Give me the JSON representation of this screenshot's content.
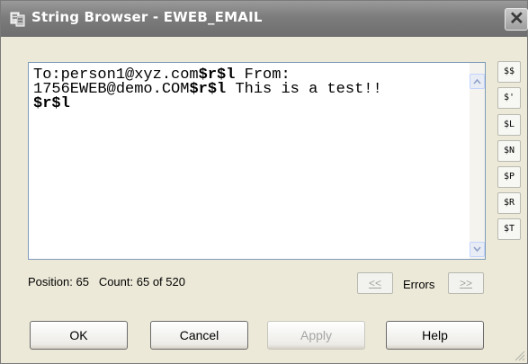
{
  "window": {
    "title": "String Browser - EWEB_EMAIL",
    "close_symbol": "✕"
  },
  "string_text": {
    "segments": [
      {
        "text": "To:person1@xyz.com",
        "bold": false
      },
      {
        "text": "$r$l",
        "bold": true
      },
      {
        "text": " From:\n1756EWEB@demo.COM",
        "bold": false
      },
      {
        "text": "$r$l",
        "bold": true
      },
      {
        "text": " This is a test!!\n",
        "bold": false
      },
      {
        "text": "$r$l",
        "bold": true
      }
    ]
  },
  "code_buttons": [
    "$$",
    "$'",
    "$L",
    "$N",
    "$P",
    "$R",
    "$T"
  ],
  "status": {
    "position_label": "Position:",
    "position_value": "65",
    "count_label": "Count:",
    "count_value": "65 of 520"
  },
  "errors": {
    "prev_label": "<<",
    "label": "Errors",
    "next_label": ">>"
  },
  "buttons": {
    "ok": "OK",
    "cancel": "Cancel",
    "apply": "Apply",
    "help": "Help"
  }
}
